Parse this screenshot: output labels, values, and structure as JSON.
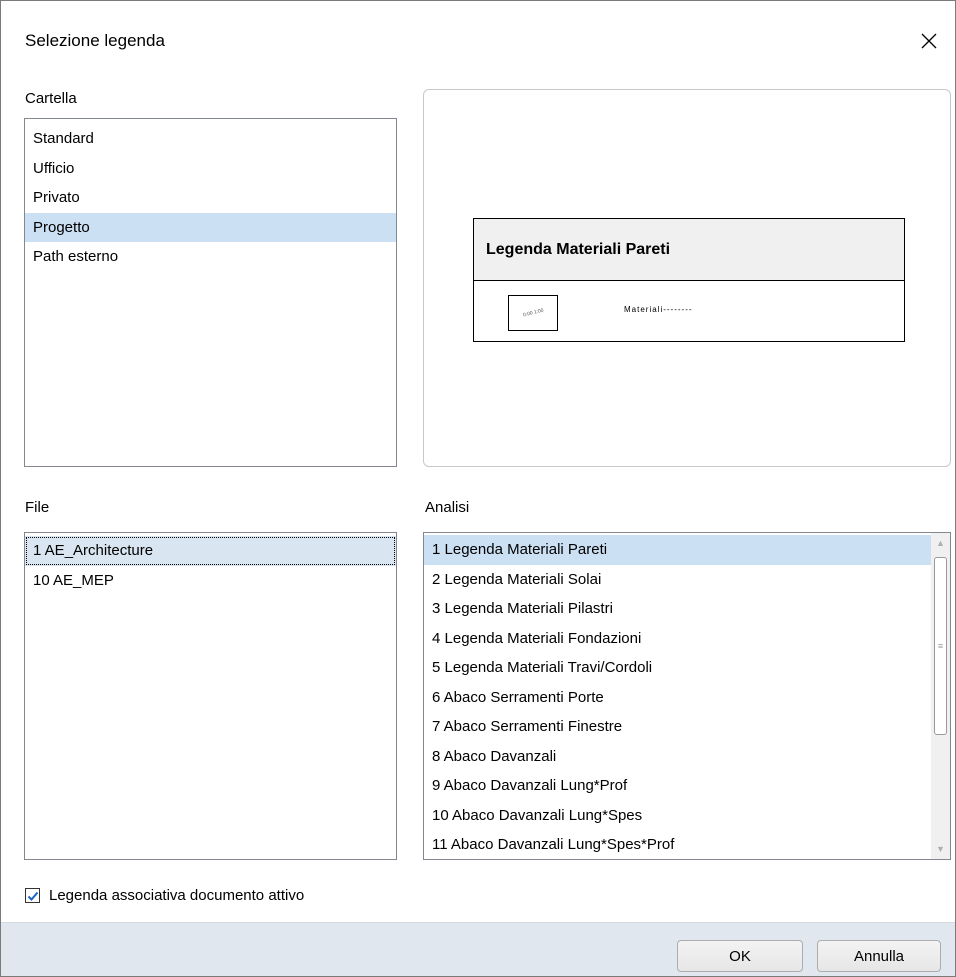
{
  "dialog": {
    "title": "Selezione legenda"
  },
  "cartella": {
    "label": "Cartella",
    "items": [
      "Standard",
      "Ufficio",
      "Privato",
      "Progetto",
      "Path esterno"
    ],
    "selected_index": 3
  },
  "preview": {
    "legend_title": "Legenda Materiali Pareti",
    "swatch_text": "0:00 1:00",
    "material_text": "Materiali--------"
  },
  "file": {
    "label": "File",
    "items": [
      "1 AE_Architecture",
      "10 AE_MEP"
    ],
    "focused_index": 0
  },
  "analisi": {
    "label": "Analisi",
    "items": [
      "1 Legenda Materiali Pareti",
      "2 Legenda Materiali Solai",
      "3 Legenda Materiali Pilastri",
      "4 Legenda Materiali Fondazioni",
      "5 Legenda Materiali Travi/Cordoli",
      "6 Abaco Serramenti Porte",
      "7 Abaco Serramenti Finestre",
      "8 Abaco Davanzali",
      "9 Abaco Davanzali Lung*Prof",
      "10 Abaco Davanzali Lung*Spes",
      "11 Abaco Davanzali Lung*Spes*Prof"
    ],
    "selected_index": 0
  },
  "checkbox": {
    "label": "Legenda associativa documento attivo",
    "checked": true
  },
  "buttons": {
    "ok": "OK",
    "cancel": "Annulla"
  },
  "colors": {
    "selection": "#cce0f4",
    "footer": "#e1e7ef",
    "check": "#1a64c8"
  }
}
